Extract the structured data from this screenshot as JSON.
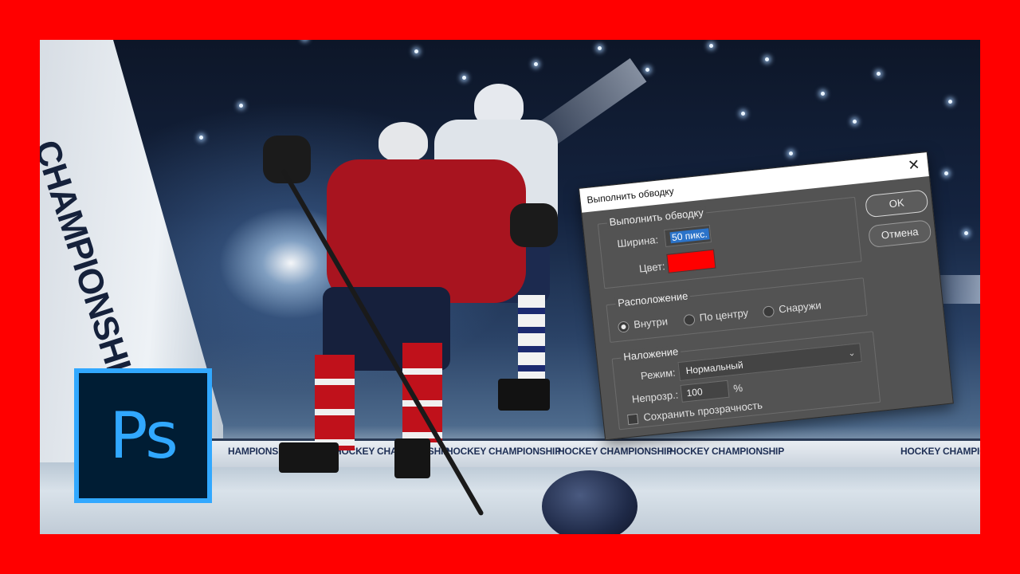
{
  "frame": {
    "border_color": "#ff0000"
  },
  "photo": {
    "wall_text": "CHAMPIONSHIP",
    "boards": [
      "HAMPIONSHIP",
      "HOCKEY CHAMPIONSHIP",
      "HOCKEY CHAMPIONSHIP",
      "HOCKEY CHAMPIONSHIP",
      "HOCKEY CHAMPIONSHIP",
      "HOCKEY CHAMPIONSHIP"
    ]
  },
  "logo": {
    "text": "Ps",
    "bg": "#001d34",
    "accent": "#31a8ff"
  },
  "dialog": {
    "title": "Выполнить обводку",
    "close_icon": "✕",
    "ok_label": "OK",
    "cancel_label": "Отмена",
    "stroke_group": {
      "title": "Выполнить обводку",
      "width_label": "Ширина:",
      "width_value": "50 пикс.",
      "color_label": "Цвет:",
      "color_value": "#ff0000"
    },
    "location_group": {
      "title": "Расположение",
      "options": [
        "Внутри",
        "По центру",
        "Снаружи"
      ],
      "selected": "Внутри"
    },
    "blending_group": {
      "title": "Наложение",
      "mode_label": "Режим:",
      "mode_value": "Нормальный",
      "opacity_label": "Непрозр.:",
      "opacity_value": "100",
      "opacity_unit": "%",
      "preserve_label": "Сохранить прозрачность"
    }
  }
}
